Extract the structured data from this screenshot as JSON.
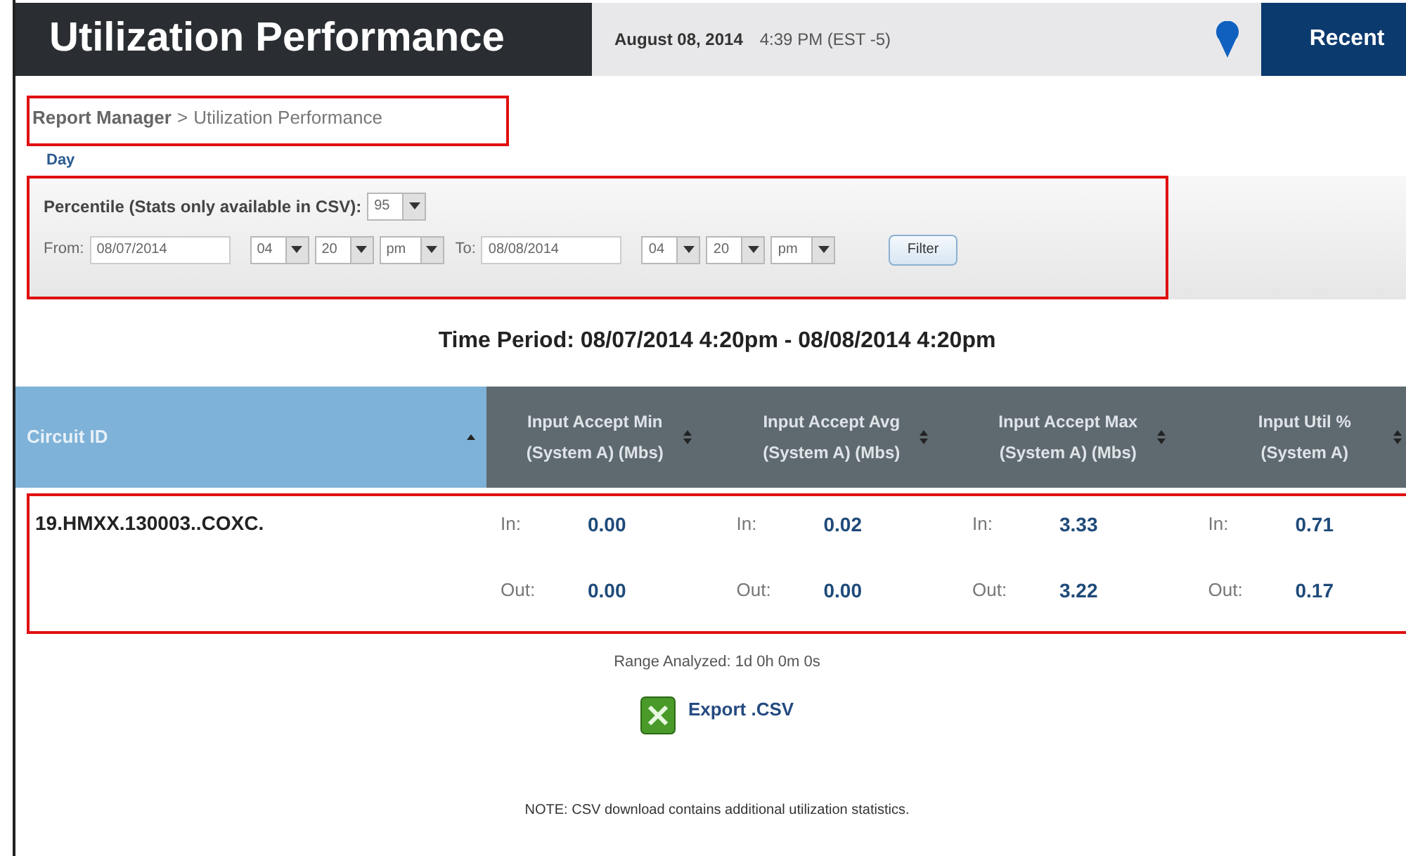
{
  "header": {
    "title": "Utilization Performance",
    "date": "August 08, 2014",
    "time": "4:39 PM (EST -5)",
    "button": "Recent"
  },
  "breadcrumb": {
    "parent": "Report Manager",
    "separator": ">",
    "current": "Utilization Performance"
  },
  "period_link": "Day",
  "filter": {
    "percentile_label": "Percentile (Stats only available in CSV):",
    "percentile": "95",
    "ranges": [
      {
        "label": "From:",
        "date": "08/07/2014",
        "hour": "04",
        "minute": "20",
        "ampm": "pm"
      },
      {
        "label": "To:",
        "date": "08/08/2014",
        "hour": "04",
        "minute": "20",
        "ampm": "pm"
      }
    ],
    "button": "Filter"
  },
  "time_period": "Time Period: 08/07/2014 4:20pm - 08/08/2014 4:20pm",
  "table": {
    "columns": [
      {
        "label": "Circuit ID",
        "kind": "primary"
      },
      {
        "label": "Input Accept Min (System A) (Mbs)",
        "kind": "metric"
      },
      {
        "label": "Input Accept Avg (System A) (Mbs)",
        "kind": "metric"
      },
      {
        "label": "Input Accept Max (System A) (Mbs)",
        "kind": "metric"
      },
      {
        "label": "Input Util % (System A)",
        "kind": "metric"
      }
    ],
    "rows": [
      {
        "cells": [
          {
            "kind": "id",
            "text": "19.HMXX.130003..COXC."
          },
          {
            "in_label": "In:",
            "in": "0.00",
            "out_label": "Out:",
            "out": "0.00"
          },
          {
            "in_label": "In:",
            "in": "0.02",
            "out_label": "Out:",
            "out": "0.00"
          },
          {
            "in_label": "In:",
            "in": "3.33",
            "out_label": "Out:",
            "out": "3.22"
          },
          {
            "in_label": "In:",
            "in": "0.71",
            "out_label": "Out:",
            "out": "0.17"
          }
        ]
      }
    ]
  },
  "range_analyzed": "Range Analyzed: 1d 0h 0m 0s",
  "export_link": "Export .CSV",
  "note": "NOTE: CSV download contains additional utilization statistics."
}
